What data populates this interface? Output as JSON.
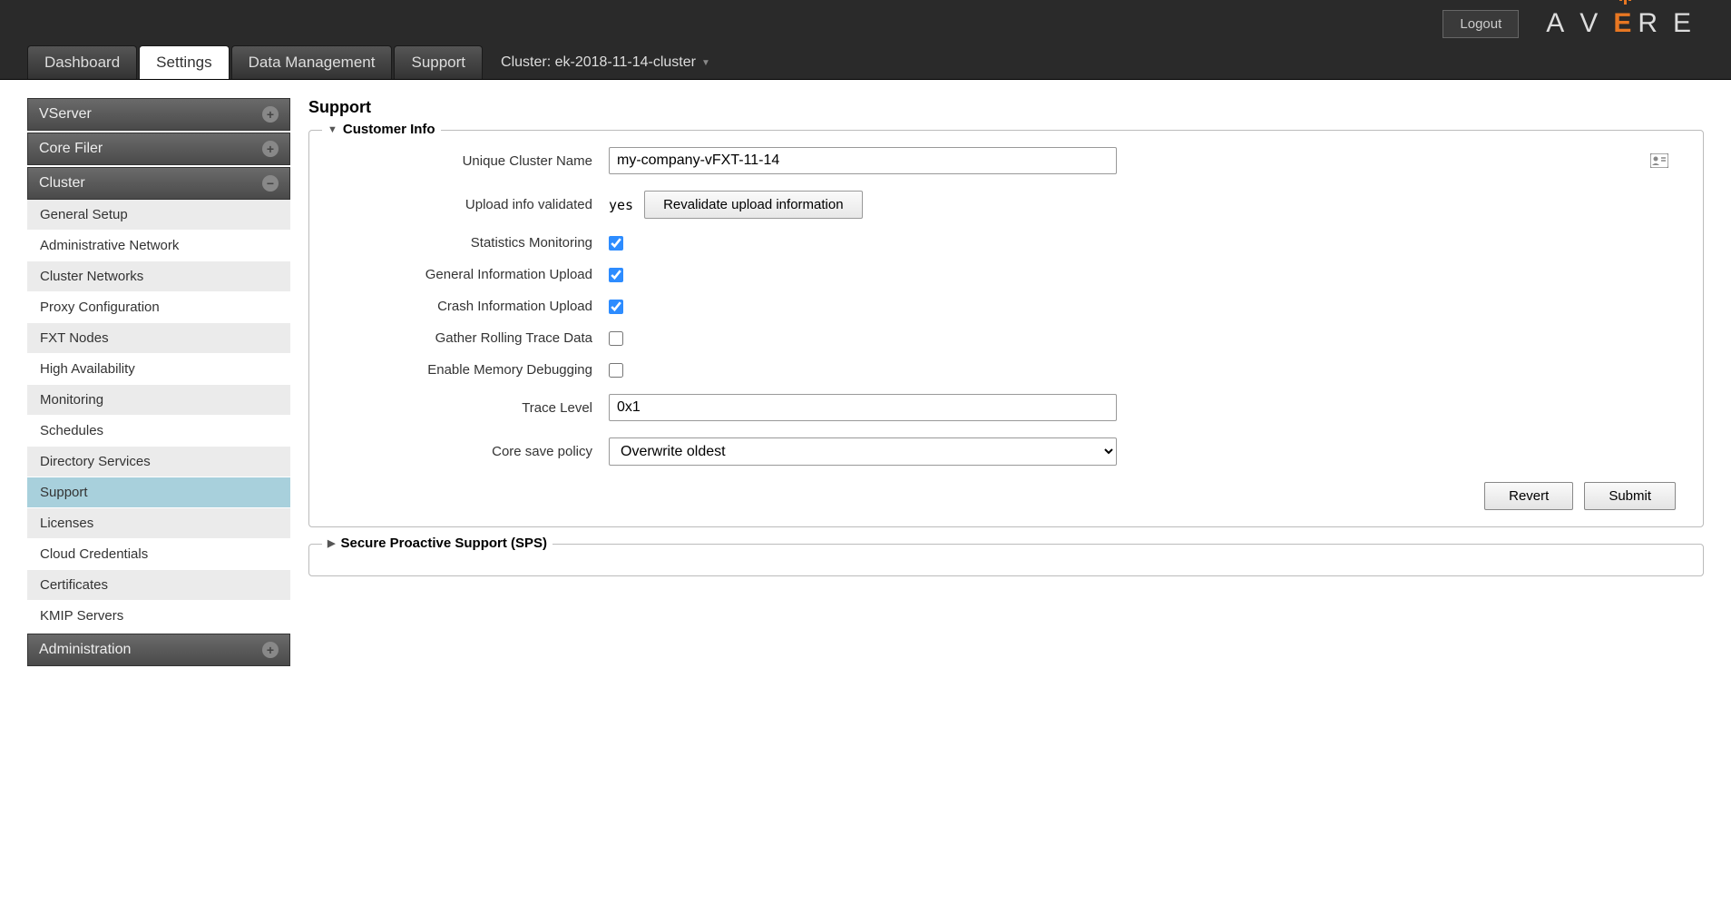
{
  "header": {
    "logout_label": "Logout",
    "logo_text": "AVERE"
  },
  "tabs": {
    "dashboard": "Dashboard",
    "settings": "Settings",
    "data_mgmt": "Data Management",
    "support": "Support",
    "cluster_label": "Cluster: ek-2018-11-14-cluster"
  },
  "sidebar": {
    "vserver": {
      "label": "VServer"
    },
    "corefiler": {
      "label": "Core Filer"
    },
    "cluster": {
      "label": "Cluster",
      "items": [
        "General Setup",
        "Administrative Network",
        "Cluster Networks",
        "Proxy Configuration",
        "FXT Nodes",
        "High Availability",
        "Monitoring",
        "Schedules",
        "Directory Services",
        "Support",
        "Licenses",
        "Cloud Credentials",
        "Certificates",
        "KMIP Servers"
      ]
    },
    "administration": {
      "label": "Administration"
    }
  },
  "page": {
    "title": "Support",
    "customer_info": {
      "legend": "Customer Info",
      "unique_cluster_name_label": "Unique Cluster Name",
      "unique_cluster_name_value": "my-company-vFXT-11-14",
      "upload_validated_label": "Upload info validated",
      "upload_validated_value": "yes",
      "revalidate_btn": "Revalidate upload information",
      "stats_monitoring_label": "Statistics Monitoring",
      "stats_monitoring_checked": true,
      "general_info_label": "General Information Upload",
      "general_info_checked": true,
      "crash_info_label": "Crash Information Upload",
      "crash_info_checked": true,
      "rolling_trace_label": "Gather Rolling Trace Data",
      "rolling_trace_checked": false,
      "memory_debug_label": "Enable Memory Debugging",
      "memory_debug_checked": false,
      "trace_level_label": "Trace Level",
      "trace_level_value": "0x1",
      "core_save_label": "Core save policy",
      "core_save_value": "Overwrite oldest",
      "revert_btn": "Revert",
      "submit_btn": "Submit"
    },
    "sps": {
      "legend": "Secure Proactive Support (SPS)"
    }
  }
}
